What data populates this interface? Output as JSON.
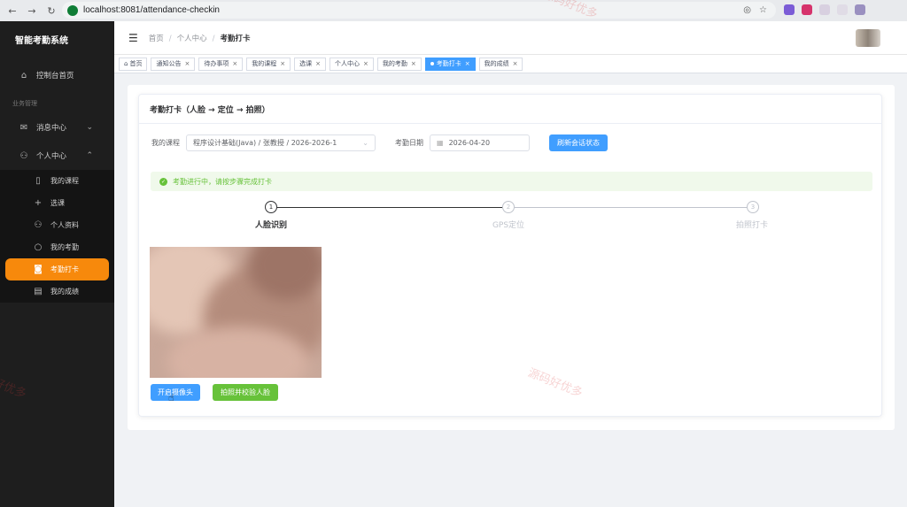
{
  "browser": {
    "url": "localhost:8081/attendance-checkin"
  },
  "sidebar": {
    "brand": "智能考勤系统",
    "dashboard": "控制台首页",
    "group_label": "业务管理",
    "message_center": "消息中心",
    "personal_center": "个人中心",
    "sub_items": [
      {
        "label": "我的课程",
        "icon": "book-icon"
      },
      {
        "label": "选课",
        "icon": "plus-icon"
      },
      {
        "label": "个人资料",
        "icon": "user-icon"
      },
      {
        "label": "我的考勤",
        "icon": "search-icon"
      },
      {
        "label": "考勤打卡",
        "icon": "camera-icon"
      },
      {
        "label": "我的成绩",
        "icon": "document-icon"
      }
    ]
  },
  "header": {
    "breadcrumb": [
      "首页",
      "个人中心",
      "考勤打卡"
    ]
  },
  "tabs": [
    {
      "label": "首页"
    },
    {
      "label": "通知公告"
    },
    {
      "label": "待办事项"
    },
    {
      "label": "我的课程"
    },
    {
      "label": "选课"
    },
    {
      "label": "个人中心"
    },
    {
      "label": "我的考勤"
    },
    {
      "label": "考勤打卡"
    },
    {
      "label": "我的成绩"
    }
  ],
  "card": {
    "title": "考勤打卡（人脸 → 定位 → 拍照）",
    "course_label": "我的课程",
    "course_value": "程序设计基础(Java) / 张教授 / 2026-2026-1",
    "date_label": "考勤日期",
    "date_value": "2026-04-20",
    "refresh_button": "刷新会话状态",
    "alert_text": "考勤进行中，请按步骤完成打卡",
    "steps": [
      {
        "num": "1",
        "label": "人脸识别"
      },
      {
        "num": "2",
        "label": "GPS定位"
      },
      {
        "num": "3",
        "label": "拍照打卡"
      }
    ],
    "open_camera_button": "开启摄像头",
    "capture_button": "拍照并校验人脸"
  },
  "watermarks": [
    "源码好优多",
    "源码好优多",
    "好优多"
  ],
  "colors": {
    "primary": "#409eff",
    "success": "#67c23a",
    "active_menu": "#f7890c",
    "sidebar_bg": "#1e1e1e"
  }
}
